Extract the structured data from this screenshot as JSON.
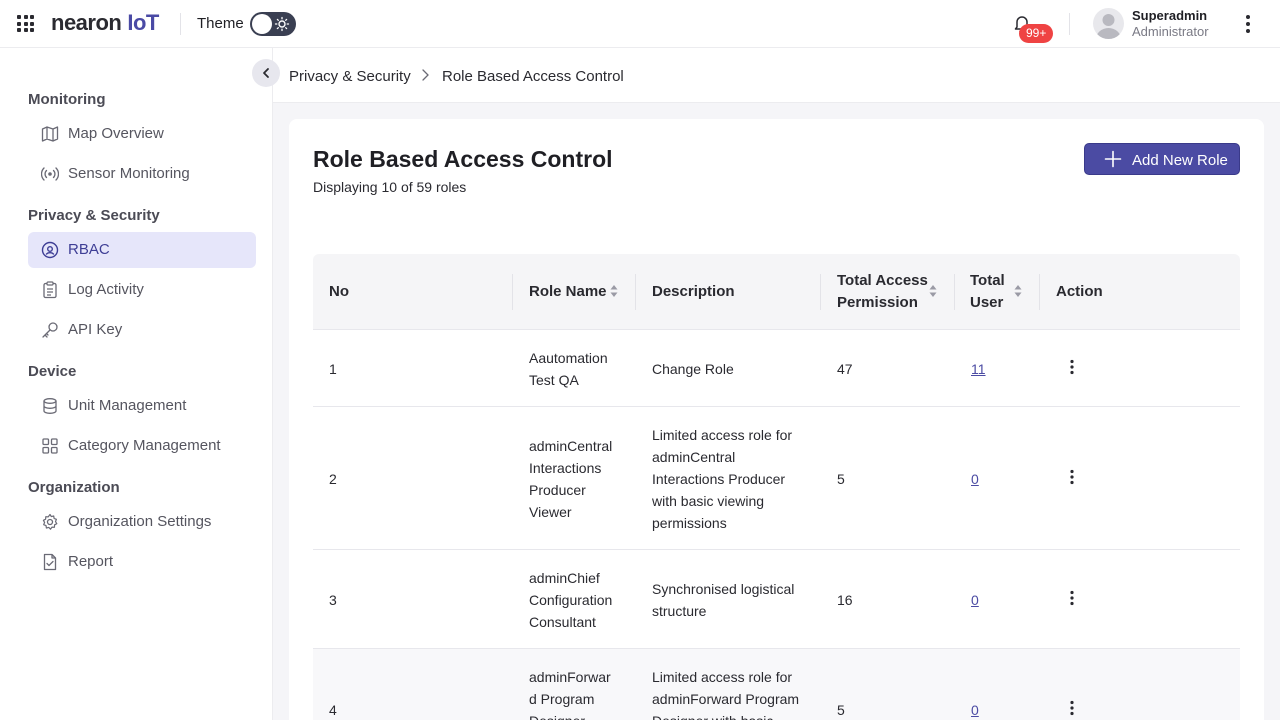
{
  "header": {
    "brand": "nearon",
    "brand_suffix": "IoT",
    "theme_label": "Theme",
    "notification_count": "99+",
    "user_name": "Superadmin",
    "user_role": "Administrator"
  },
  "sidebar": {
    "sections": [
      {
        "title": "Monitoring",
        "items": [
          {
            "label": "Map Overview",
            "icon": "map-icon"
          },
          {
            "label": "Sensor Monitoring",
            "icon": "sensor-icon"
          }
        ]
      },
      {
        "title": "Privacy & Security",
        "items": [
          {
            "label": "RBAC",
            "icon": "shield-icon",
            "active": true
          },
          {
            "label": "Log Activity",
            "icon": "log-icon"
          },
          {
            "label": "API Key",
            "icon": "key-icon"
          }
        ]
      },
      {
        "title": "Device",
        "items": [
          {
            "label": "Unit Management",
            "icon": "database-icon"
          },
          {
            "label": "Category Management",
            "icon": "category-icon"
          }
        ]
      },
      {
        "title": "Organization",
        "items": [
          {
            "label": "Organization Settings",
            "icon": "gear-icon"
          },
          {
            "label": "Report",
            "icon": "report-icon"
          }
        ]
      }
    ]
  },
  "breadcrumb": [
    "Privacy & Security",
    "Role Based Access Control"
  ],
  "page": {
    "title": "Role Based Access Control",
    "subtitle": "Displaying 10 of 59 roles",
    "add_button": "Add New Role"
  },
  "table": {
    "columns": [
      "No",
      "Role Name",
      "Description",
      "Total Access Permission",
      "Total User",
      "Action"
    ],
    "column_lines": {
      "total_access": [
        "Total Access",
        "Permission"
      ],
      "total_user": [
        "Total",
        "User"
      ]
    },
    "rows": [
      {
        "no": "1",
        "role_lines": [
          "Aautomation",
          "Test QA"
        ],
        "desc_lines": [
          "Change Role"
        ],
        "perm": "47",
        "users": "11"
      },
      {
        "no": "2",
        "role_lines": [
          "adminCentral",
          "Interactions",
          "Producer",
          "Viewer"
        ],
        "desc_lines": [
          "Limited access role for",
          "adminCentral",
          "Interactions Producer",
          "with basic viewing",
          "permissions"
        ],
        "perm": "5",
        "users": "0"
      },
      {
        "no": "3",
        "role_lines": [
          "adminChief",
          "Configuration",
          "Consultant"
        ],
        "desc_lines": [
          "Synchronised logistical",
          "structure"
        ],
        "perm": "16",
        "users": "0"
      },
      {
        "no": "4",
        "role_lines": [
          "adminForwar",
          "d Program",
          "Designer"
        ],
        "desc_lines": [
          "Limited access role for",
          "adminForward Program",
          "Designer with basic"
        ],
        "perm": "5",
        "users": "0"
      }
    ]
  },
  "colors": {
    "accent": "#4b4ba3",
    "badge": "#ef4343",
    "active_bg": "#e6e6fa"
  }
}
